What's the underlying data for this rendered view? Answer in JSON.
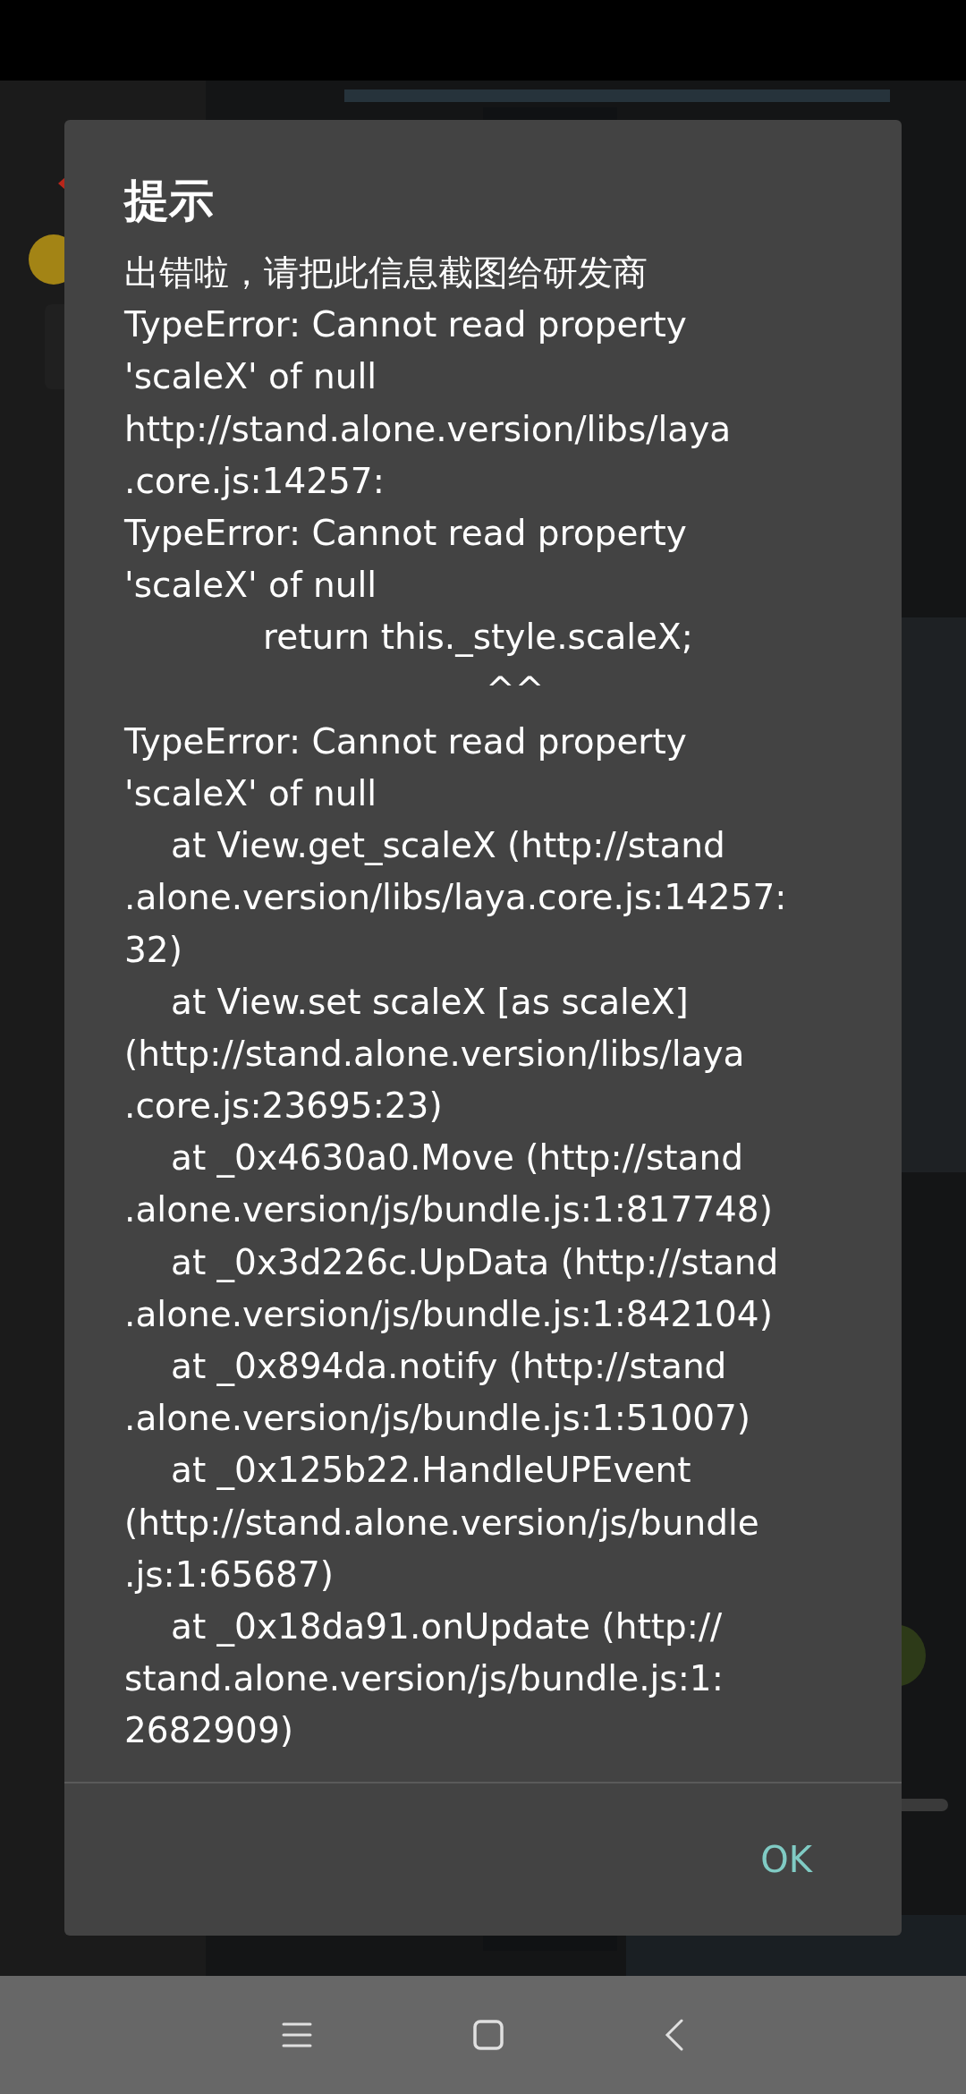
{
  "dialog": {
    "title": "提示",
    "lines": [
      {
        "kind": "plain",
        "text": "出错啦，请把此信息截图给研发商"
      },
      {
        "kind": "plain",
        "text": "TypeError: Cannot read property"
      },
      {
        "kind": "plain",
        "text": "'scaleX' of null"
      },
      {
        "kind": "plain",
        "text": "http://stand.alone.version/libs/laya"
      },
      {
        "kind": "plain",
        "text": ".core.js:14257:"
      },
      {
        "kind": "plain",
        "text": "TypeError: Cannot read property"
      },
      {
        "kind": "plain",
        "text": "'scaleX' of null"
      },
      {
        "kind": "code",
        "text": "return this._style.scaleX;"
      },
      {
        "kind": "caret",
        "text": "^^"
      },
      {
        "kind": "plain",
        "text": "TypeError: Cannot read property"
      },
      {
        "kind": "plain",
        "text": "'scaleX' of null"
      },
      {
        "kind": "indented",
        "text": "at View.get_scaleX (http://stand"
      },
      {
        "kind": "plain",
        "text": ".alone.version/libs/laya.core.js:14257:"
      },
      {
        "kind": "plain",
        "text": "32)"
      },
      {
        "kind": "indented",
        "text": "at View.set scaleX [as scaleX]"
      },
      {
        "kind": "plain",
        "text": "(http://stand.alone.version/libs/laya"
      },
      {
        "kind": "plain",
        "text": ".core.js:23695:23)"
      },
      {
        "kind": "indented",
        "text": "at _0x4630a0.Move (http://stand"
      },
      {
        "kind": "plain",
        "text": ".alone.version/js/bundle.js:1:817748)"
      },
      {
        "kind": "indented",
        "text": "at _0x3d226c.UpData (http://stand"
      },
      {
        "kind": "plain",
        "text": ".alone.version/js/bundle.js:1:842104)"
      },
      {
        "kind": "indented",
        "text": "at _0x894da.notify (http://stand"
      },
      {
        "kind": "plain",
        "text": ".alone.version/js/bundle.js:1:51007)"
      },
      {
        "kind": "indented",
        "text": "at _0x125b22.HandleUPEvent"
      },
      {
        "kind": "plain",
        "text": "(http://stand.alone.version/js/bundle"
      },
      {
        "kind": "plain",
        "text": ".js:1:65687)"
      },
      {
        "kind": "indented",
        "text": "at _0x18da91.onUpdate (http://"
      },
      {
        "kind": "plain",
        "text": "stand.alone.version/js/bundle.js:1:"
      },
      {
        "kind": "plain",
        "text": "2682909)"
      }
    ],
    "buttons": [
      "OK"
    ]
  }
}
